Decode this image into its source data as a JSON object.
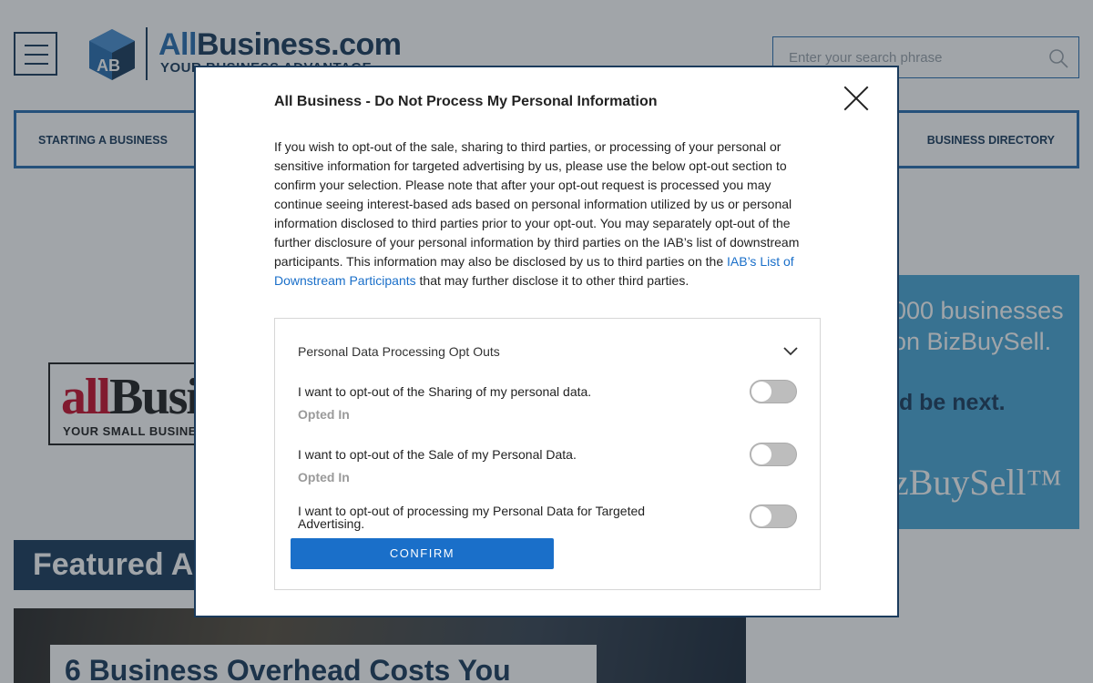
{
  "site": {
    "logo": {
      "brand_prefix": "All",
      "brand_main": "Business.com",
      "tagline": "YOUR BUSINESS ADVANTAGE",
      "icon": "allbusiness-cube-logo"
    },
    "search": {
      "placeholder": "Enter your search phrase"
    },
    "nav": {
      "left_item": "STARTING A BUSINESS",
      "right_item": "BUSINESS DIRECTORY"
    },
    "ad_left": {
      "big_prefix": "all",
      "big_main": "Busin",
      "small": "YOUR SMALL BUSINESS"
    },
    "ad_right": {
      "line1": "000 businesses",
      "line2": "on BizBuySell.",
      "line3": "ld be next.",
      "line4": "zBuySell™"
    },
    "featured_heading": "Featured A",
    "article_title": "6 Business Overhead Costs You"
  },
  "modal": {
    "title": "All Business - Do Not Process My Personal Information",
    "body_text": "If you wish to opt-out of the sale, sharing to third parties, or processing of your personal or sensitive information for targeted advertising by us, please use the below opt-out section to confirm your selection. Please note that after your opt-out request is processed you may continue seeing interest-based ads based on personal information utilized by us or personal information disclosed to third parties prior to your opt-out. You may separately opt-out of the further disclosure of your personal information by third parties on the IAB’s list of downstream participants. This information may also be disclosed by us to third parties on the ",
    "body_link": "IAB’s List of Downstream Participants",
    "body_after": " that may further disclose it to other third parties.",
    "section_header": "Personal Data Processing Opt Outs",
    "options": [
      {
        "label": "I want to opt-out of the Sharing of my personal data.",
        "status": "Opted In",
        "toggled": false
      },
      {
        "label": "I want to opt-out of the Sale of my Personal Data.",
        "status": "Opted In",
        "toggled": false
      },
      {
        "label": "I want to opt-out of processing my Personal Data for Targeted Advertising.",
        "status": "",
        "toggled": false
      }
    ],
    "confirm_label": "CONFIRM"
  },
  "colors": {
    "brand_navy": "#1b3b5c",
    "brand_blue": "#2a6fb0",
    "link_blue": "#1a6fc9",
    "toggle_off": "#bdbdbd",
    "ad_blue": "#4aa8d6"
  }
}
